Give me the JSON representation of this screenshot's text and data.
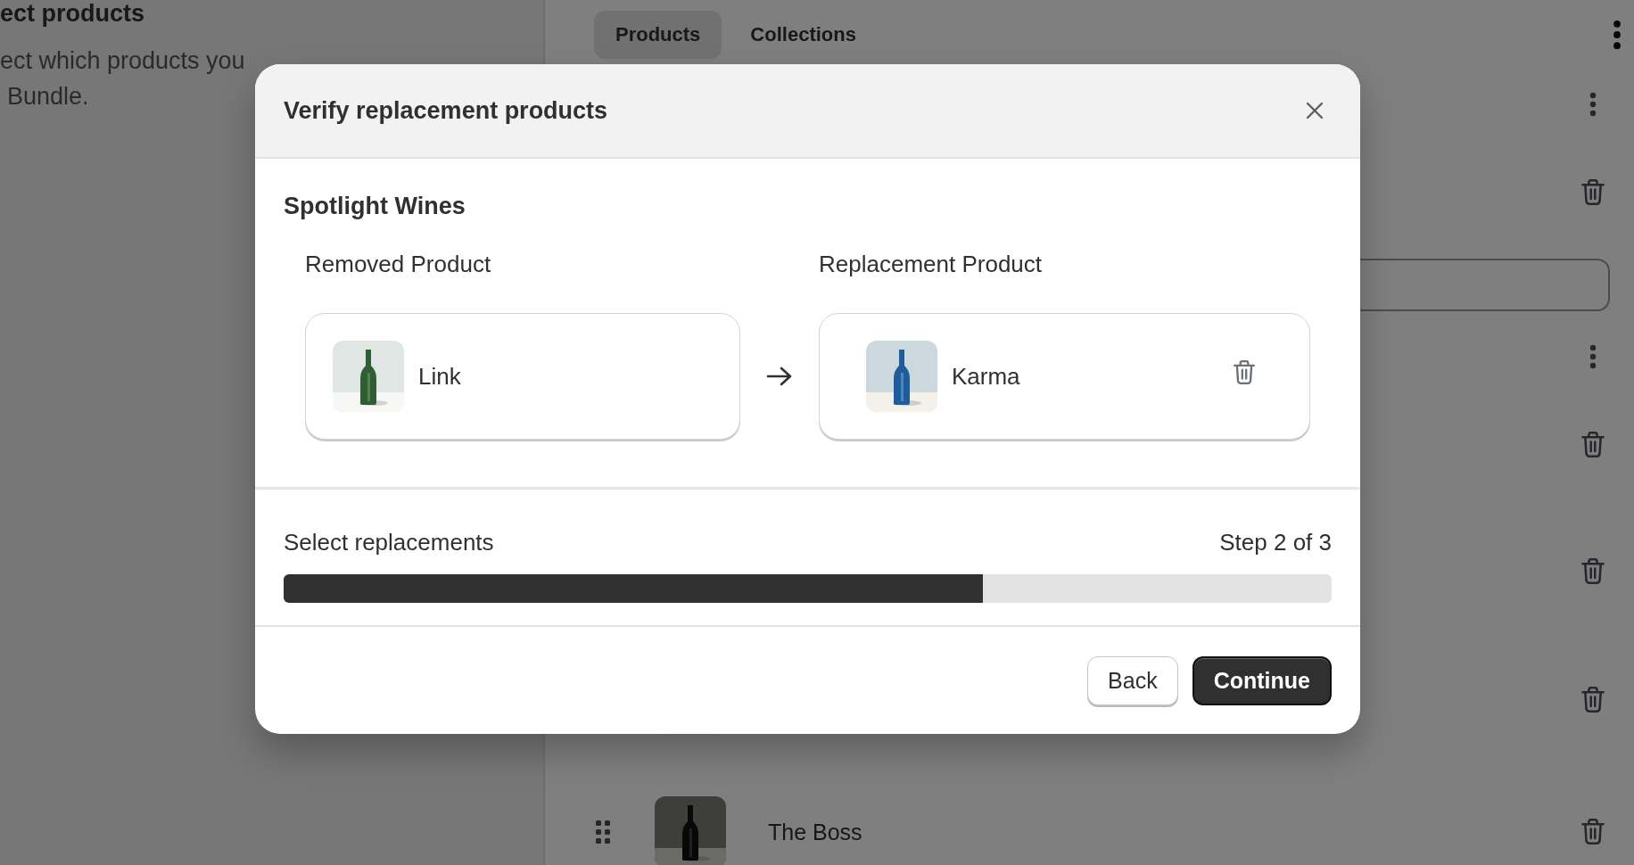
{
  "background": {
    "panel_title": "ect products",
    "panel_description": [
      "ect which products you",
      "Bundle."
    ],
    "tabs": [
      {
        "label": "Products",
        "selected": true
      },
      {
        "label": "Collections",
        "selected": false
      }
    ],
    "rows": [
      {
        "kind": "menu"
      },
      {
        "kind": "trash"
      },
      {
        "kind": "field"
      },
      {
        "kind": "menu"
      },
      {
        "kind": "trash"
      },
      {
        "kind": "trash"
      },
      {
        "kind": "product"
      },
      {
        "kind": "product",
        "name": "The Boss"
      }
    ]
  },
  "modal": {
    "title": "Verify replacement products",
    "section_title": "Spotlight Wines",
    "removed_label": "Removed Product",
    "replacement_label": "Replacement Product",
    "removed_product": {
      "name": "Link"
    },
    "replacement_product": {
      "name": "Karma"
    },
    "progress": {
      "label": "Select replacements",
      "step": "Step 2 of 3",
      "level": 0.667
    },
    "buttons": [
      {
        "label": "Back",
        "kind": "secondary"
      },
      {
        "label": "Continue",
        "kind": "primary"
      }
    ]
  }
}
